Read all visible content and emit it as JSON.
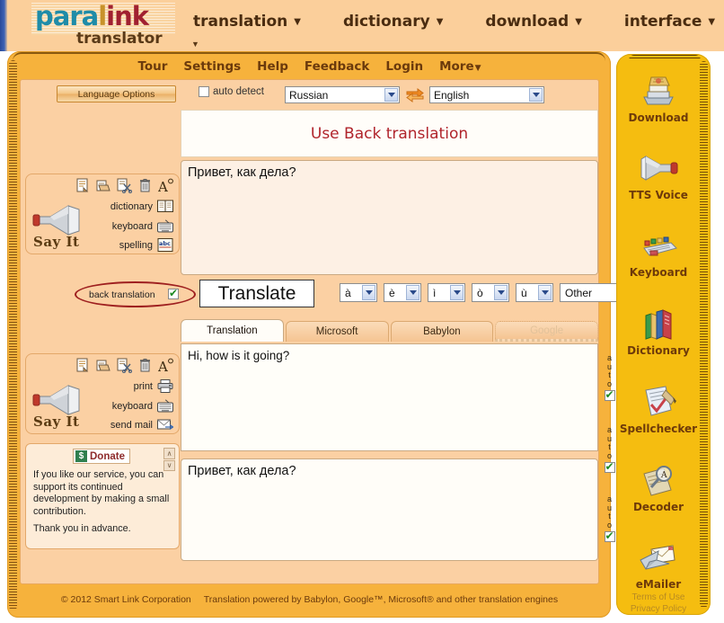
{
  "header": {
    "logo": {
      "part1": "para",
      "part2": "l",
      "part3": "ink",
      "sub": "translator",
      "caret": "▼"
    },
    "nav": [
      {
        "label": "translation",
        "caret": "▼"
      },
      {
        "label": "dictionary",
        "caret": "▼"
      },
      {
        "label": "download",
        "caret": "▼"
      },
      {
        "label": "interface",
        "caret": "▼"
      }
    ]
  },
  "menubar": [
    {
      "label": "Tour"
    },
    {
      "label": "Settings"
    },
    {
      "label": "Help"
    },
    {
      "label": "Feedback"
    },
    {
      "label": "Login"
    },
    {
      "label": "More",
      "caret": "▼"
    }
  ],
  "language_bar": {
    "options_button": "Language Options",
    "auto_detect_label": "auto detect",
    "auto_detect_checked": false,
    "source_language": "Russian",
    "target_language": "English",
    "swap_title": "swap languages"
  },
  "banner": {
    "text": "Use Back translation"
  },
  "source_panel": {
    "icons": [
      "new-document-icon",
      "copy-icon",
      "cut-icon",
      "trash-icon",
      "font-size-icon"
    ],
    "links": [
      {
        "label": "dictionary",
        "icon": "book-icon"
      },
      {
        "label": "keyboard",
        "icon": "keyboard-icon"
      },
      {
        "label": "spelling",
        "icon": "abc-spelling-icon"
      }
    ],
    "say_it": "Say It"
  },
  "result_panel": {
    "icons": [
      "new-document-icon",
      "copy-icon",
      "cut-icon",
      "trash-icon",
      "font-size-icon"
    ],
    "links": [
      {
        "label": "print",
        "icon": "printer-icon"
      },
      {
        "label": "keyboard",
        "icon": "keyboard-icon"
      },
      {
        "label": "send mail",
        "icon": "mail-icon"
      }
    ],
    "say_it": "Say It"
  },
  "textareas": {
    "source_text": "Привет, как дела?",
    "result_text": "Hi, how is it going?",
    "back_text": "Привет, как дела?"
  },
  "translate_row": {
    "back_translation_label": "back translation",
    "back_translation_checked": true,
    "translate_button": "Translate",
    "accents": [
      "à",
      "è",
      "ì",
      "ò",
      "ù"
    ],
    "other_label": "Other"
  },
  "tabs": [
    {
      "label": "Translation",
      "state": "active"
    },
    {
      "label": "Microsoft",
      "state": "normal"
    },
    {
      "label": "Babylon",
      "state": "normal"
    },
    {
      "label": "Google",
      "state": "disabled"
    }
  ],
  "donate": {
    "badge": "$",
    "button_label": "Donate",
    "body": "If you like our service, you can support its continued development by making a small contribution.",
    "thanks": "Thank you in advance.",
    "up": "∧",
    "down": "∨"
  },
  "auto_checkboxes": [
    {
      "label": "auto",
      "checked": true
    },
    {
      "label": "auto",
      "checked": true
    },
    {
      "label": "auto",
      "checked": true
    }
  ],
  "footer": {
    "copyright": "© 2012 Smart Link Corporation",
    "powered": "Translation powered by Babylon, Google™, Microsoft® and other translation engines"
  },
  "sidebar": {
    "items": [
      {
        "label": "Download",
        "icon": "download-books-icon"
      },
      {
        "label": "TTS Voice",
        "icon": "megaphone-icon"
      },
      {
        "label": "Keyboard",
        "icon": "keyboard-color-icon"
      },
      {
        "label": "Dictionary",
        "icon": "books-icon"
      },
      {
        "label": "Spellchecker",
        "icon": "checked-page-icon"
      },
      {
        "label": "Decoder",
        "icon": "magnifier-page-icon"
      },
      {
        "label": "eMailer",
        "icon": "envelope-plane-icon"
      }
    ],
    "legal": {
      "terms": "Terms of Use",
      "privacy": "Privacy Policy"
    }
  },
  "colors": {
    "header_bg": "#fbcf9b",
    "panel_orange": "#f6b23c",
    "content_bg": "#fbd0a3",
    "sidebar_yellow": "#f5bd10",
    "brand_red": "#a02030",
    "brand_teal": "#1f8ca8",
    "banner_red": "#b0242c"
  }
}
